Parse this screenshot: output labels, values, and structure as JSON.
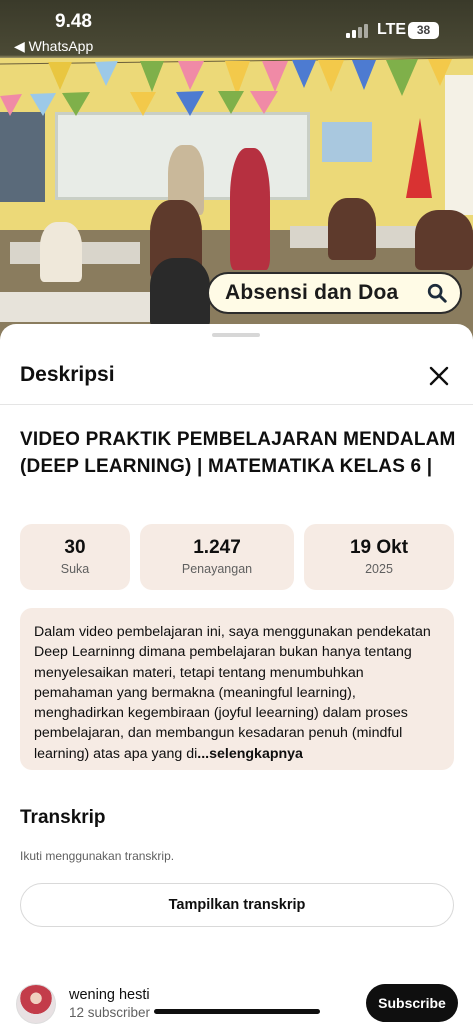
{
  "status_bar": {
    "time": "9.48",
    "back_app": "◀ WhatsApp",
    "network": "LTE",
    "battery": "38"
  },
  "video": {
    "overlay_text": "Absensi dan Doa"
  },
  "sheet": {
    "title": "Deskripsi",
    "video_title": "VIDEO PRAKTIK PEMBELAJARAN MENDALAM (DEEP LEARNING) | MATEMATIKA KELAS 6 |",
    "stats": [
      {
        "value": "30",
        "label": "Suka"
      },
      {
        "value": "1.247",
        "label": "Penayangan"
      },
      {
        "value": "19 Okt",
        "label": "2025"
      }
    ],
    "description": "Dalam video pembelajaran ini, saya menggunakan pendekatan Deep Learninng dimana pembelajaran bukan hanya tentang menyelesaikan materi, tetapi tentang menumbuhkan pemahaman yang bermakna (meaningful learning), menghadirkan kegembiraan (joyful leearning) dalam proses pembelajaran, dan membangun kesadaran penuh (mindful learning) atas apa yang di",
    "more_label": "...selengkapnya",
    "transcript": {
      "title": "Transkrip",
      "subtitle": "Ikuti menggunakan transkrip.",
      "button": "Tampilkan transkrip"
    },
    "channel": {
      "name": "wening hesti",
      "subscribers": "12 subscriber",
      "subscribe_button": "Subscribe"
    }
  },
  "icons": {
    "search": "search-icon",
    "close": "close-icon"
  },
  "colors": {
    "card_bg": "#f6ebe4",
    "button_dark": "#0f0f0f",
    "overlay_pill": "#fffbe6"
  }
}
